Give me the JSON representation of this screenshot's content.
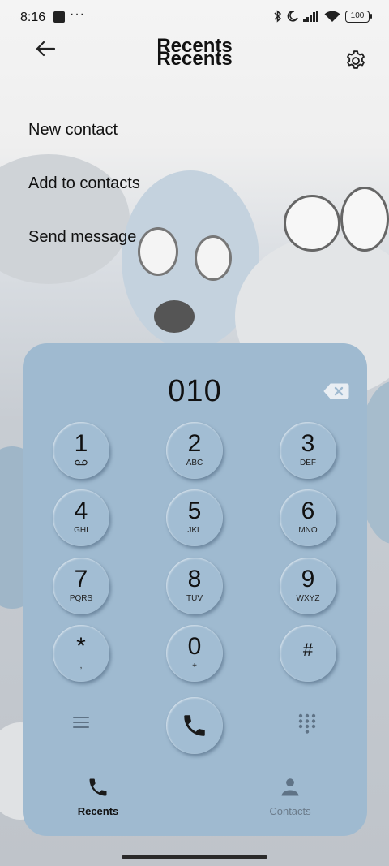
{
  "status_bar": {
    "time": "8:16",
    "dots": "···",
    "battery": "100",
    "icons": [
      "bluetooth-icon",
      "moon-icon",
      "signal-icon",
      "wifi-icon",
      "battery-icon"
    ]
  },
  "header": {
    "title": "Recents",
    "title_echo": "Recents",
    "back_icon": "back-arrow-icon",
    "settings_icon": "gear-icon"
  },
  "menu": {
    "items": [
      {
        "label": "New contact"
      },
      {
        "label": "Add to contacts"
      },
      {
        "label": "Send message"
      }
    ]
  },
  "dialer": {
    "number": "010",
    "keys": [
      {
        "digit": "1",
        "sub": ""
      },
      {
        "digit": "2",
        "sub": "ABC"
      },
      {
        "digit": "3",
        "sub": "DEF"
      },
      {
        "digit": "4",
        "sub": "GHI"
      },
      {
        "digit": "5",
        "sub": "JKL"
      },
      {
        "digit": "6",
        "sub": "MNO"
      },
      {
        "digit": "7",
        "sub": "PQRS"
      },
      {
        "digit": "8",
        "sub": "TUV"
      },
      {
        "digit": "9",
        "sub": "WXYZ"
      },
      {
        "digit": "*",
        "sub": ","
      },
      {
        "digit": "0",
        "sub": "+"
      },
      {
        "digit": "#",
        "sub": ""
      }
    ],
    "colors": {
      "panel": "#9fbad0",
      "key": "#a2bdd3"
    }
  },
  "tabs": [
    {
      "label": "Recents",
      "active": true
    },
    {
      "label": "Contacts",
      "active": false
    }
  ]
}
